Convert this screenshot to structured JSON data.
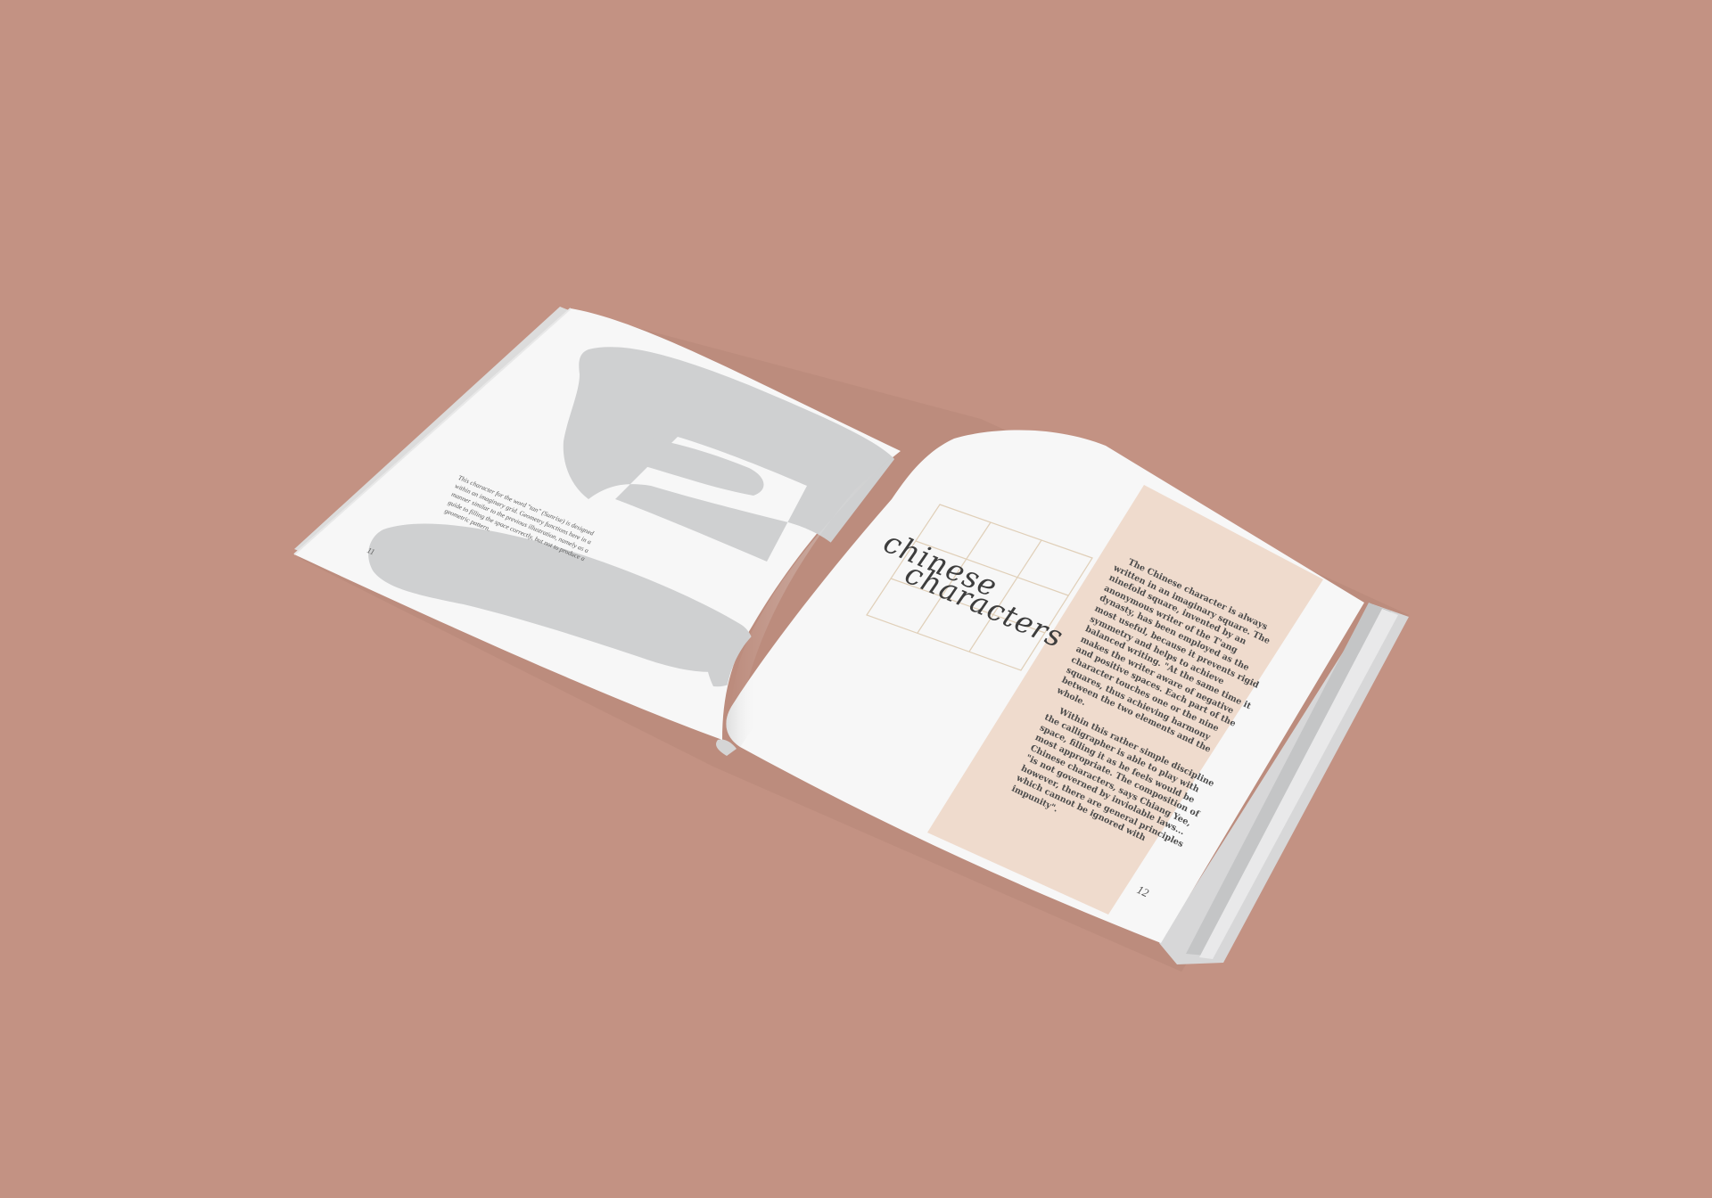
{
  "book": {
    "left_page": {
      "caption": "This character for the word \"tan\" (Sunrise) is designed within an imaginary grid. Geometry functions here in a manner similar to the previous illustration, namely as a guide to filling the space correctly, but not to produce a geometric pattern.",
      "folio": "11"
    },
    "right_page": {
      "title_line1": "chinese",
      "title_line2": "characters",
      "body_para1": "The Chinese character is always written in an imaginary square. The ninefold square, invented by an anonymous writer of the T'ang dynasty, has been employed as the most useful, because it prevents rigid symmetry and helps to achieve balanced writing. \"At the same time it makes the writer aware of negative and positive spaces. Each part of the character touches one or the nine squares, thus achieving harmony between the two elements and the whole.",
      "body_para2": "Within this rather simple discipline the calligrapher is able to play with space, filling it as he feels would be most appropriate. The composition of Chinese characters, says Chiang Yee, \"is not governed by inviolable laws... however, there are general principles which cannot be ignored with impunity\".",
      "folio": "12"
    }
  },
  "colors": {
    "background": "#c39283",
    "page": "#f7f7f7",
    "panel": "#efdbcd",
    "glyph": "#cfd0d1",
    "grid_line": "#e0cfb8"
  }
}
